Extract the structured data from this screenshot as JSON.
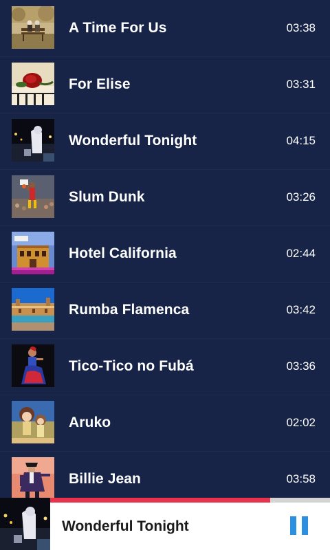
{
  "songs": [
    {
      "title": "A Time For Us",
      "duration": "03:38",
      "art": "bench-couple-art"
    },
    {
      "title": "For Elise",
      "duration": "03:31",
      "art": "rose-piano-art"
    },
    {
      "title": "Wonderful Tonight",
      "duration": "04:15",
      "art": "night-city-art"
    },
    {
      "title": "Slum Dunk",
      "duration": "03:26",
      "art": "basketball-art"
    },
    {
      "title": "Hotel California",
      "duration": "02:44",
      "art": "hotel-art"
    },
    {
      "title": "Rumba Flamenca",
      "duration": "03:42",
      "art": "plaza-art"
    },
    {
      "title": "Tico-Tico no Fubá",
      "duration": "03:36",
      "art": "dancer-art"
    },
    {
      "title": "Aruko",
      "duration": "02:02",
      "art": "anime-art"
    },
    {
      "title": "Billie Jean",
      "duration": "03:58",
      "art": "singer-art"
    }
  ],
  "player": {
    "title": "Wonderful Tonight",
    "progress": 0.786,
    "state": "playing",
    "control_icon": "pause-icon",
    "art": "night-city-art"
  },
  "colors": {
    "background": "#172447",
    "progress": "#e8334f",
    "progress_track": "#d4d4d4",
    "control": "#2d8fe0"
  }
}
